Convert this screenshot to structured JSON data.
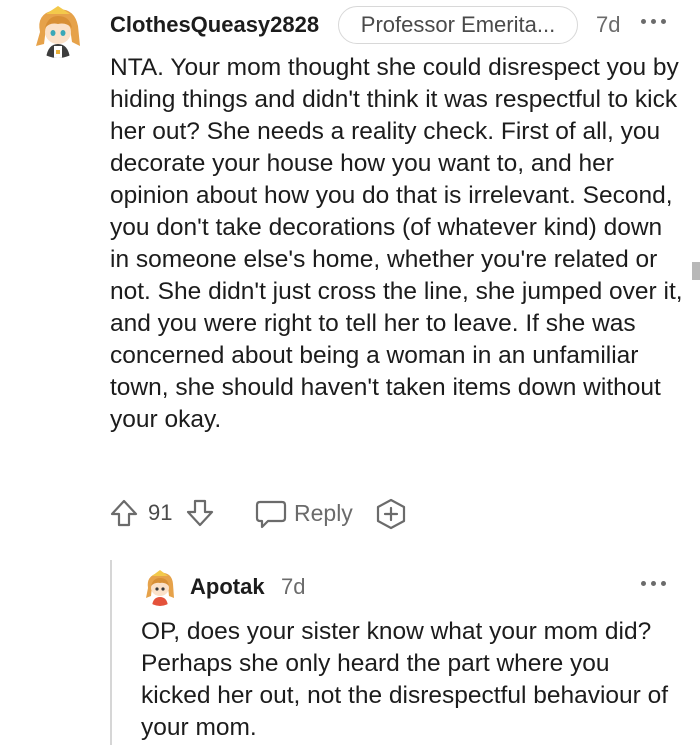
{
  "comments": [
    {
      "username": "ClothesQueasy2828",
      "flair": "Professor Emerita...",
      "age": "7d",
      "more_icon": "more-horizontal-icon",
      "body": "NTA. Your mom thought she could disrespect you by hiding things and didn't think it was respectful to kick her out? She needs a reality check. First of all, you decorate your house how you want to, and her opinion about how you do that is irrelevant. Second, you don't take decorations (of whatever kind) down in someone else's home, whether you're related or not. She didn't just cross the line, she jumped over it, and you were right to tell her to leave. If she was concerned about being a woman in an unfamiliar town, she should haven't taken items down without your okay.",
      "score": "91",
      "reply_label": "Reply",
      "icons": {
        "upvote": "arrow-up-icon",
        "downvote": "arrow-down-icon",
        "reply": "chat-bubble-icon",
        "award": "award-plus-icon"
      }
    },
    {
      "username": "Apotak",
      "age": "7d",
      "more_icon": "more-horizontal-icon",
      "body": "OP, does your sister know what your mom did? Perhaps she only heard the part where you kicked her out, not the disrespectful behaviour of your mom."
    }
  ],
  "colors": {
    "text": "#1c1c1c",
    "meta": "#6b6b6b",
    "thread_line": "#d6d6d6",
    "avatar_hair": "#e6a24a",
    "avatar_skin": "#fbe1c8"
  }
}
